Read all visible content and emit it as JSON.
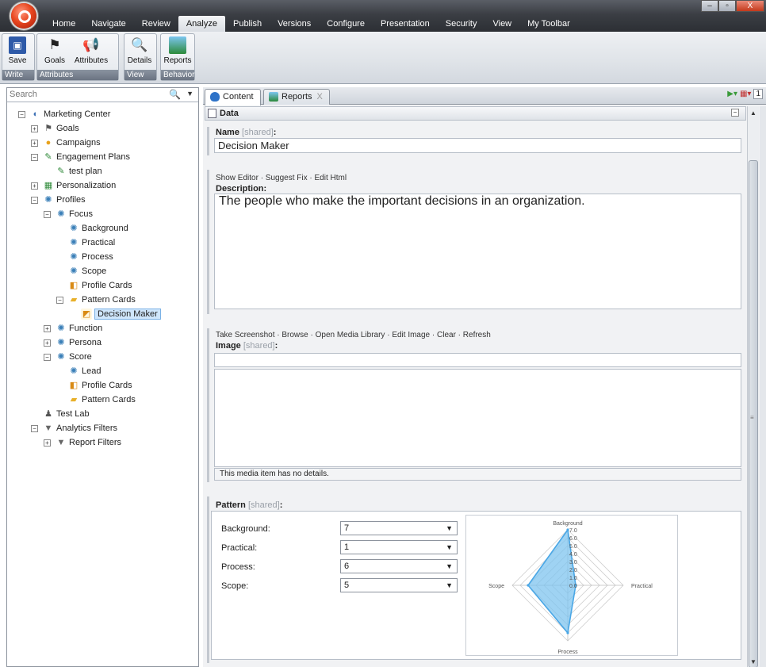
{
  "menu": {
    "items": [
      "Home",
      "Navigate",
      "Review",
      "Analyze",
      "Publish",
      "Versions",
      "Configure",
      "Presentation",
      "Security",
      "View",
      "My Toolbar"
    ],
    "active": "Analyze"
  },
  "window_controls": {
    "minimize": "‒",
    "maximize": "▫",
    "close": "X"
  },
  "ribbon": {
    "groups": [
      {
        "caption": "Write",
        "buttons": [
          {
            "label": "Save",
            "icon": "save-icon"
          }
        ]
      },
      {
        "caption": "Attributes",
        "buttons": [
          {
            "label": "Goals",
            "icon": "flag-icon"
          },
          {
            "label": "Attributes",
            "icon": "megaphone-icon"
          }
        ]
      },
      {
        "caption": "View",
        "buttons": [
          {
            "label": "Details",
            "icon": "magnifier-icon"
          }
        ]
      },
      {
        "caption": "Behavior",
        "buttons": [
          {
            "label": "Reports",
            "icon": "chart-icon"
          }
        ]
      }
    ]
  },
  "search": {
    "placeholder": "Search"
  },
  "tree": [
    {
      "label": "Marketing Center",
      "depth": 1,
      "toggle": "−",
      "icon": "globe-icon"
    },
    {
      "label": "Goals",
      "depth": 2,
      "toggle": "+",
      "icon": "flag-icon"
    },
    {
      "label": "Campaigns",
      "depth": 2,
      "toggle": "+",
      "icon": "campaign-icon"
    },
    {
      "label": "Engagement Plans",
      "depth": 2,
      "toggle": "−",
      "icon": "plan-icon"
    },
    {
      "label": "test plan",
      "depth": 3,
      "toggle": "",
      "icon": "plan-icon"
    },
    {
      "label": "Personalization",
      "depth": 2,
      "toggle": "+",
      "icon": "grid-icon"
    },
    {
      "label": "Profiles",
      "depth": 2,
      "toggle": "−",
      "icon": "profile-icon"
    },
    {
      "label": "Focus",
      "depth": 3,
      "toggle": "−",
      "icon": "profile-icon"
    },
    {
      "label": "Background",
      "depth": 4,
      "toggle": "",
      "icon": "profile-icon"
    },
    {
      "label": "Practical",
      "depth": 4,
      "toggle": "",
      "icon": "profile-icon"
    },
    {
      "label": "Process",
      "depth": 4,
      "toggle": "",
      "icon": "profile-icon"
    },
    {
      "label": "Scope",
      "depth": 4,
      "toggle": "",
      "icon": "profile-icon"
    },
    {
      "label": "Profile Cards",
      "depth": 4,
      "toggle": "",
      "icon": "cards-icon"
    },
    {
      "label": "Pattern Cards",
      "depth": 4,
      "toggle": "−",
      "icon": "folder-icon"
    },
    {
      "label": "Decision Maker",
      "depth": 5,
      "toggle": "",
      "icon": "card-icon",
      "selected": true
    },
    {
      "label": "Function",
      "depth": 3,
      "toggle": "+",
      "icon": "profile-icon"
    },
    {
      "label": "Persona",
      "depth": 3,
      "toggle": "+",
      "icon": "profile-icon"
    },
    {
      "label": "Score",
      "depth": 3,
      "toggle": "−",
      "icon": "profile-icon"
    },
    {
      "label": "Lead",
      "depth": 4,
      "toggle": "",
      "icon": "profile-icon"
    },
    {
      "label": "Profile Cards",
      "depth": 4,
      "toggle": "",
      "icon": "cards-icon"
    },
    {
      "label": "Pattern Cards",
      "depth": 4,
      "toggle": "",
      "icon": "folder-icon"
    },
    {
      "label": "Test Lab",
      "depth": 2,
      "toggle": "",
      "icon": "testlab-icon"
    },
    {
      "label": "Analytics Filters",
      "depth": 2,
      "toggle": "−",
      "icon": "filter-icon"
    },
    {
      "label": "Report Filters",
      "depth": 3,
      "toggle": "+",
      "icon": "filter-icon"
    }
  ],
  "tabs": [
    {
      "label": "Content",
      "icon": "content-icon",
      "active": true
    },
    {
      "label": "Reports",
      "icon": "chart-icon",
      "active": false,
      "close": "X"
    }
  ],
  "tab_controls": {
    "language_number": "1"
  },
  "section": {
    "title": "Data"
  },
  "fields": {
    "name": {
      "label": "Name",
      "shared": "[shared]",
      "value": "Decision Maker"
    },
    "description": {
      "actions": "Show Editor · Suggest Fix · Edit Html",
      "label": "Description:",
      "value": "The people who make the important decisions in an organization."
    },
    "image": {
      "actions": "Take Screenshot · Browse · Open Media Library · Edit Image · Clear · Refresh",
      "label": "Image",
      "shared": "[shared]",
      "details": "This media item has no details."
    },
    "pattern": {
      "label": "Pattern",
      "shared": "[shared]",
      "rows": [
        {
          "label": "Background:",
          "value": "7"
        },
        {
          "label": "Practical:",
          "value": "1"
        },
        {
          "label": "Process:",
          "value": "6"
        },
        {
          "label": "Scope:",
          "value": "5"
        }
      ]
    }
  },
  "chart_data": {
    "type": "radar",
    "axes": [
      "Background",
      "Practical",
      "Process",
      "Scope"
    ],
    "values": [
      7,
      1,
      6,
      5
    ],
    "ticks": [
      "0.0",
      "1.0",
      "2.0",
      "3.0",
      "4.0",
      "5.0",
      "6.0",
      "7.0"
    ],
    "range": [
      0,
      7
    ],
    "fill": "#7fc4ef",
    "stroke": "#4aa7e6"
  }
}
